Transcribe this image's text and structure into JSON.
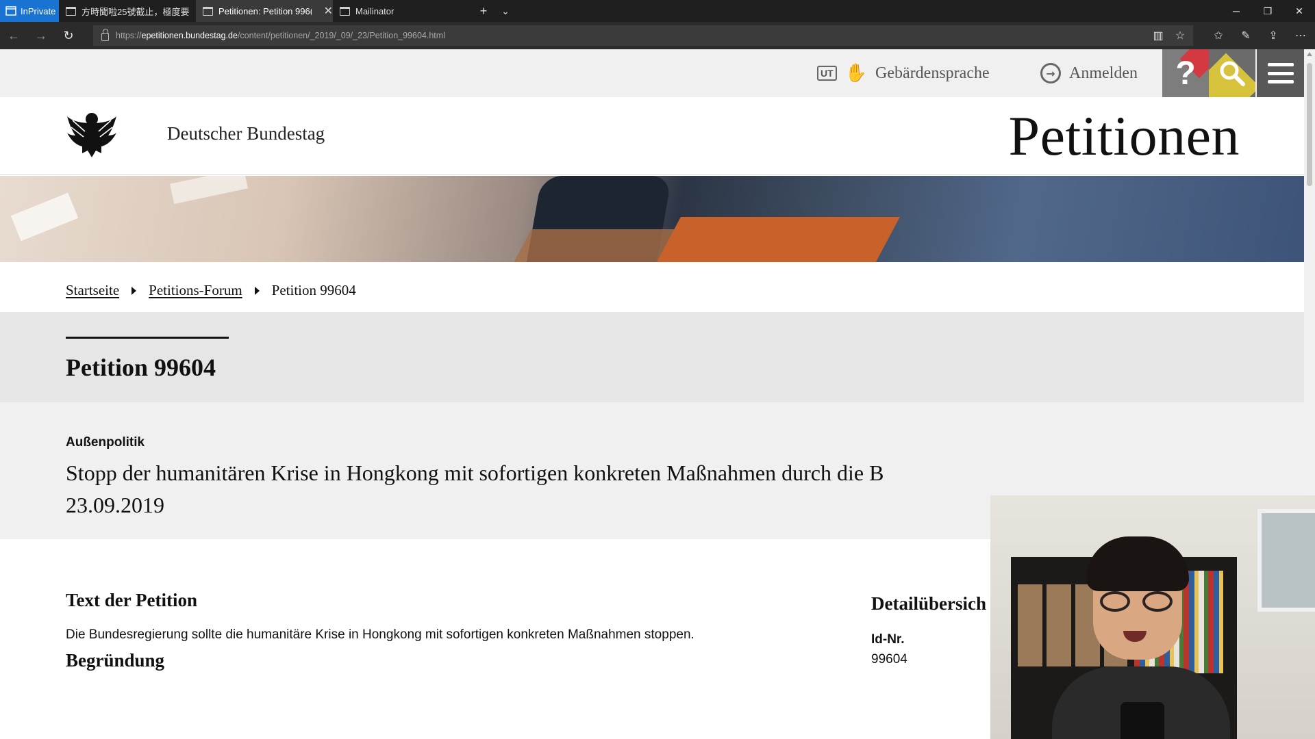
{
  "browser": {
    "inprivate_label": "InPrivate",
    "tabs": [
      {
        "title": "方時聞啦25號截止，極度要"
      },
      {
        "title": "Petitionen: Petition 996("
      },
      {
        "title": "Mailinator"
      }
    ],
    "url_prefix": "https://",
    "url_host": "epetitionen.bundestag.de",
    "url_path": "/content/petitionen/_2019/_09/_23/Petition_99604.html"
  },
  "utility_bar": {
    "ut_badge": "UT",
    "sign_language": "Gebärdensprache",
    "login": "Anmelden",
    "help_glyph": "?"
  },
  "header": {
    "institution": "Deutscher Bundestag",
    "site_title": "Petitionen"
  },
  "breadcrumb": {
    "items": [
      "Startseite",
      "Petitions-Forum"
    ],
    "current": "Petition 99604"
  },
  "petition": {
    "title": "Petition 99604",
    "category": "Außenpolitik",
    "headline_line1": "Stopp der humanitären Krise in Hongkong mit sofortigen konkreten Maßnahmen durch die B",
    "headline_line2": "23.09.2019",
    "text_heading": "Text der Petition",
    "text_body": "Die Bundesregierung sollte die humanitäre Krise in Hongkong mit sofortigen konkreten Maßnahmen stoppen.",
    "reason_heading": "Begründung",
    "details_heading": "Detailübersich",
    "id_label": "Id-Nr.",
    "id_value": "99604"
  },
  "colors": {
    "inprivate_blue": "#1873d3",
    "chrome_dark": "#1f1f1f",
    "title_band": "#e6e6e6",
    "sub_band": "#f0f0f0"
  }
}
